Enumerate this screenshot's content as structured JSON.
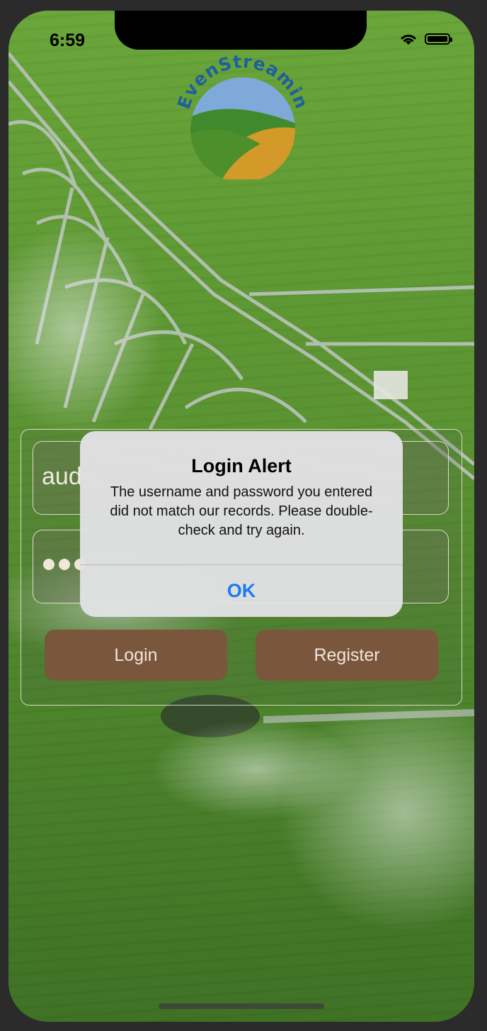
{
  "status_bar": {
    "time": "6:59"
  },
  "app": {
    "logo_text": "EvenStreamin"
  },
  "login_form": {
    "username_value": "aud",
    "password_dots": 3,
    "login_label": "Login",
    "register_label": "Register"
  },
  "alert": {
    "title": "Login Alert",
    "message": "The username and password you entered did not match our records. Please double-check and try again.",
    "ok_label": "OK"
  },
  "colors": {
    "button": "#7a563c",
    "alert_action": "#1a7cf0",
    "logo_text": "#1f5f9e"
  }
}
